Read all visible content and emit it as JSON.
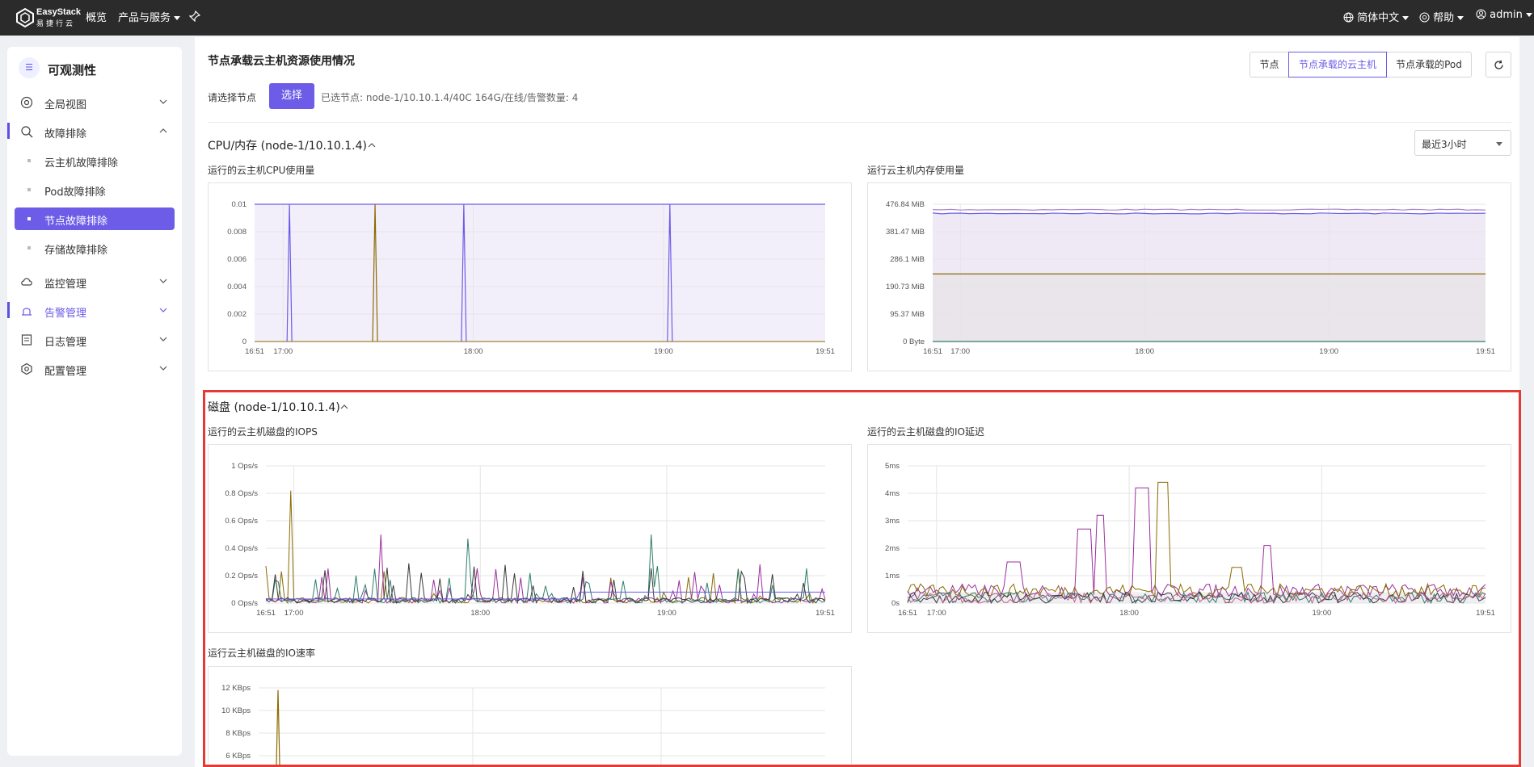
{
  "topbar": {
    "brand_en": "EasyStack",
    "brand_cn": "易捷行云",
    "nav": [
      "概览",
      "产品与服务"
    ],
    "language": "简体中文",
    "help": "帮助",
    "user": "admin"
  },
  "sidebar": {
    "title": "可观测性",
    "items": [
      {
        "label": "全局视图",
        "icon": "globe-icon"
      },
      {
        "label": "故障排除",
        "icon": "troubleshoot-icon",
        "expanded": true
      },
      {
        "label": "监控管理",
        "icon": "cloud-monitor-icon"
      },
      {
        "label": "告警管理",
        "icon": "alarm-icon",
        "highlighted": true
      },
      {
        "label": "日志管理",
        "icon": "log-icon"
      },
      {
        "label": "配置管理",
        "icon": "config-icon"
      }
    ],
    "sub_items": [
      {
        "label": "云主机故障排除"
      },
      {
        "label": "Pod故障排除"
      },
      {
        "label": "节点故障排除",
        "active": true
      },
      {
        "label": "存储故障排除"
      }
    ]
  },
  "main": {
    "title": "节点承载云主机资源使用情况",
    "tabs": [
      {
        "label": "节点"
      },
      {
        "label": "节点承载的云主机",
        "active": true
      },
      {
        "label": "节点承载的Pod"
      }
    ],
    "select_label": "请选择节点",
    "select_button": "选择",
    "selected_info": "已选节点:  node-1/10.10.1.4/40C 164G/在线/告警数量: 4",
    "section_cpu": "CPU/内存 (node-1/10.10.1.4)",
    "time_range": "最近3小时",
    "section_disk": "磁盘 (node-1/10.10.1.4)"
  },
  "colors": {
    "accent": "#6c5ce7",
    "highlight_box": "#e53935"
  },
  "chart_data": [
    {
      "type": "area",
      "title": "运行的云主机CPU使用量",
      "y_ticks": [
        "0.01",
        "0.008",
        "0.006",
        "0.004",
        "0.002",
        "0"
      ],
      "x_ticks": [
        "16:51",
        "17:00",
        "18:00",
        "19:00",
        "19:51"
      ],
      "ylim": [
        0,
        0.01
      ],
      "series": [
        {
          "color": "#6c5ce7",
          "spikes_at": [
            "17:02",
            "17:57",
            "19:02"
          ],
          "values": [
            0.01,
            0.01,
            0.01
          ]
        },
        {
          "color": "#8a6a00",
          "spikes_at": [
            "17:29"
          ],
          "values": [
            0.01
          ]
        }
      ],
      "baseline_fill": 0.01
    },
    {
      "type": "area",
      "title": "运行云主机内存使用量",
      "y_ticks": [
        "476.84 MiB",
        "381.47 MiB",
        "286.1 MiB",
        "190.73 MiB",
        "95.37 MiB",
        "0 Byte"
      ],
      "x_ticks": [
        "16:51",
        "17:00",
        "18:00",
        "19:00",
        "19:51"
      ],
      "ylim": [
        0,
        476.84
      ],
      "series": [
        {
          "color": "#6c5ce7",
          "value": 445
        },
        {
          "color": "#aa88cc",
          "value": 458
        },
        {
          "color": "#8a6a00",
          "value": 235
        },
        {
          "color": "#2e7d6a",
          "value": 0
        }
      ]
    },
    {
      "type": "line",
      "title": "运行的云主机磁盘的IOPS",
      "y_ticks": [
        "1 Ops/s",
        "0.8 Ops/s",
        "0.6 Ops/s",
        "0.4 Ops/s",
        "0.2 Ops/s",
        "0 Ops/s"
      ],
      "x_ticks": [
        "16:51",
        "17:00",
        "18:00",
        "19:00",
        "19:51"
      ],
      "ylim": [
        0,
        1
      ],
      "peaks": [
        0.82,
        0.5,
        0.47,
        0.5
      ]
    },
    {
      "type": "line",
      "title": "运行的云主机磁盘的IO延迟",
      "y_ticks": [
        "5ms",
        "4ms",
        "3ms",
        "2ms",
        "1ms",
        "0s"
      ],
      "x_ticks": [
        "16:51",
        "17:00",
        "18:00",
        "19:00",
        "19:51"
      ],
      "ylim": [
        0,
        5
      ],
      "peaks": [
        4.4,
        4.2,
        3.2,
        2.1
      ]
    },
    {
      "type": "line",
      "title": "运行云主机磁盘的IO速率",
      "y_ticks": [
        "12 KBps",
        "10 KBps",
        "8 KBps",
        "6 KBps"
      ],
      "x_ticks": [],
      "ylim": [
        0,
        12
      ],
      "peaks": [
        11.8
      ]
    }
  ]
}
